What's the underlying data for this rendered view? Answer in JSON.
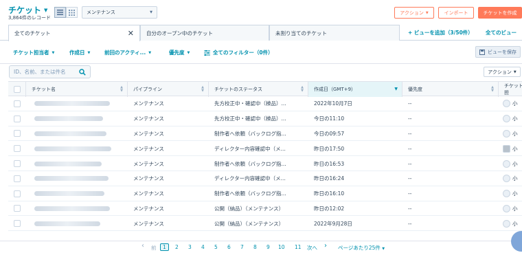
{
  "header": {
    "title": "チケット",
    "record_count": "3,864件のレコード",
    "pipeline_select": "メンテナンス",
    "actions_label": "アクション",
    "import_label": "インポート",
    "create_label": "チケットを作成"
  },
  "tabs": {
    "items": [
      {
        "label": "全てのチケット"
      },
      {
        "label": "自分のオープン中のチケット"
      },
      {
        "label": "未割り当てのチケット"
      }
    ],
    "add_view": "+ ビューを追加（3/50件）",
    "all_views": "全てのビュー"
  },
  "filters": {
    "owner": "チケット担当者",
    "created": "作成日",
    "last_activity": "前回のアクティ...",
    "priority": "優先度",
    "all_filters": "全てのフィルター（0件）",
    "save_view": "ビューを保存"
  },
  "search": {
    "placeholder": "ID、名前、または件名",
    "actions": "アクション"
  },
  "table": {
    "columns": [
      "チケット名",
      "パイプライン",
      "チケットのステータス",
      "作成日（GMT+9）",
      "優先度",
      "チケット担"
    ],
    "rows": [
      {
        "pipeline": "メンテナンス",
        "status": "先方校正中・確認中（検品）...",
        "created": "2022年10月7日",
        "priority": "--",
        "owner": "小"
      },
      {
        "pipeline": "メンテナンス",
        "status": "先方校正中・確認中（検品）...",
        "created": "今日の11:10",
        "priority": "--",
        "owner": "小"
      },
      {
        "pipeline": "メンテナンス",
        "status": "制作者へ依頼（バックログ指...",
        "created": "今日の09:57",
        "priority": "--",
        "owner": "小"
      },
      {
        "pipeline": "メンテナンス",
        "status": "ディレクター内容確認中（メ...",
        "created": "昨日の17:50",
        "priority": "--",
        "owner": "小"
      },
      {
        "pipeline": "メンテナンス",
        "status": "制作者へ依頼（バックログ指...",
        "created": "昨日の16:53",
        "priority": "--",
        "owner": "小"
      },
      {
        "pipeline": "メンテナンス",
        "status": "ディレクター内容確認中（メ...",
        "created": "昨日の16:24",
        "priority": "--",
        "owner": "小"
      },
      {
        "pipeline": "メンテナンス",
        "status": "制作者へ依頼（バックログ指...",
        "created": "昨日の16:10",
        "priority": "--",
        "owner": "小"
      },
      {
        "pipeline": "メンテナンス",
        "status": "公開（納品）（メンテナンス）",
        "created": "昨日の12:02",
        "priority": "--",
        "owner": "小"
      },
      {
        "pipeline": "メンテナンス",
        "status": "公開（納品）（メンテナンス）",
        "created": "2022年9月28日",
        "priority": "--",
        "owner": "小"
      }
    ]
  },
  "pagination": {
    "prev": "前",
    "pages": [
      "1",
      "2",
      "3",
      "4",
      "5",
      "6",
      "7",
      "8",
      "9",
      "10",
      "11"
    ],
    "next": "次へ",
    "per_page": "ページあたり25件"
  },
  "colors": {
    "accent": "#0091ae",
    "brand": "#ff7a59"
  }
}
